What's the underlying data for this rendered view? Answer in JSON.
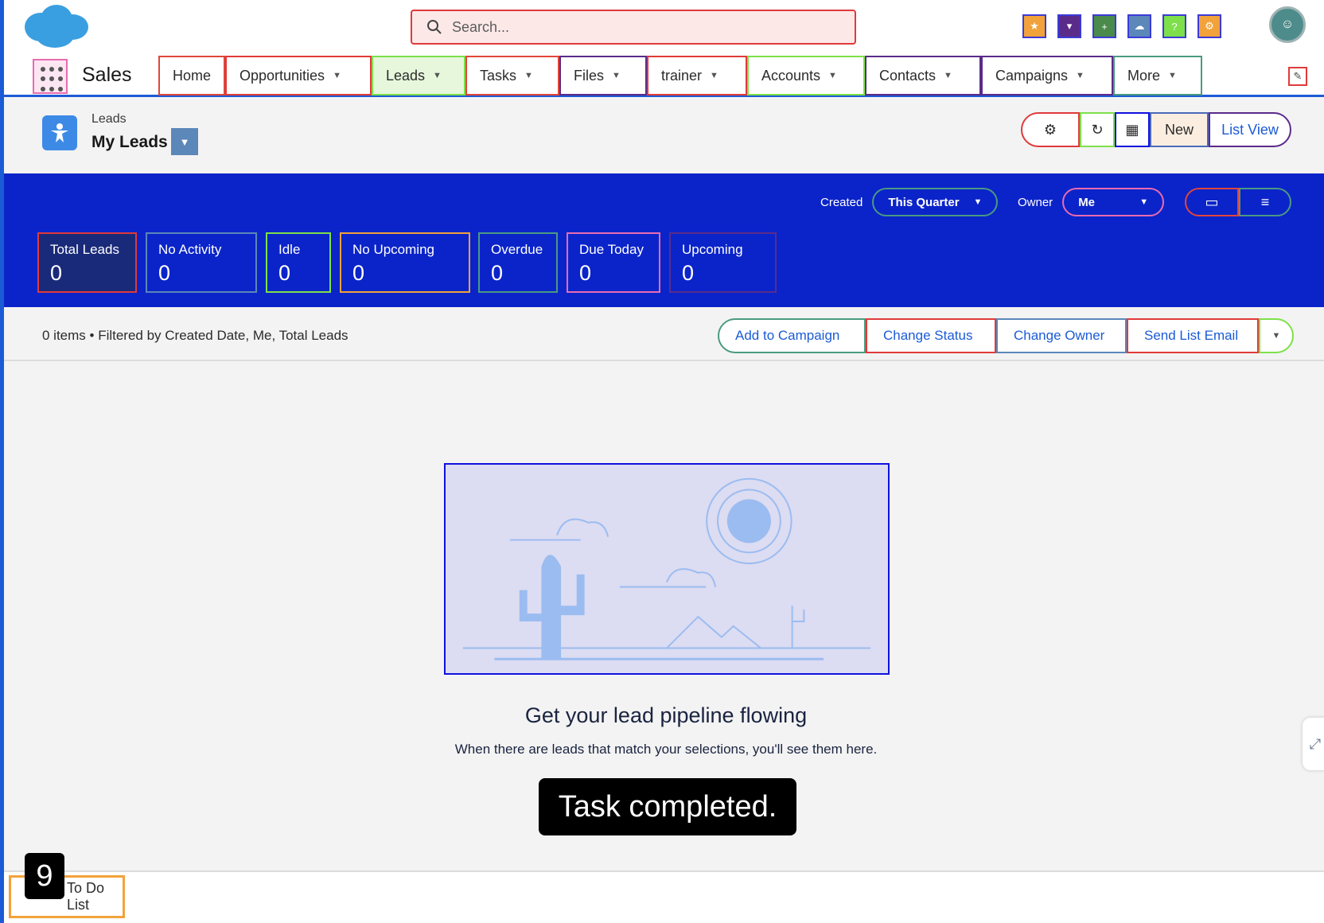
{
  "header": {
    "search_placeholder": "Search...",
    "avatar_initial": ""
  },
  "nav": {
    "app_name": "Sales",
    "tabs": [
      {
        "label": "Home",
        "has_menu": false
      },
      {
        "label": "Opportunities",
        "has_menu": true
      },
      {
        "label": "Leads",
        "has_menu": true
      },
      {
        "label": "Tasks",
        "has_menu": true
      },
      {
        "label": "Files",
        "has_menu": true
      },
      {
        "label": "trainer",
        "has_menu": true
      },
      {
        "label": "Accounts",
        "has_menu": true
      },
      {
        "label": "Contacts",
        "has_menu": true
      },
      {
        "label": "Campaigns",
        "has_menu": true
      },
      {
        "label": "More",
        "has_menu": true
      }
    ]
  },
  "page": {
    "object_label": "Leads",
    "view_title": "My Leads",
    "actions": {
      "new_label": "New",
      "list_view_label": "List View"
    }
  },
  "filters": {
    "created_label": "Created",
    "created_value": "This Quarter",
    "owner_label": "Owner",
    "owner_value": "Me"
  },
  "metrics": [
    {
      "label": "Total Leads",
      "value": "0"
    },
    {
      "label": "No Activity",
      "value": "0"
    },
    {
      "label": "Idle",
      "value": "0"
    },
    {
      "label": "No Upcoming",
      "value": "0"
    },
    {
      "label": "Overdue",
      "value": "0"
    },
    {
      "label": "Due Today",
      "value": "0"
    },
    {
      "label": "Upcoming",
      "value": "0"
    }
  ],
  "list": {
    "info": "0 items • Filtered by Created Date, Me, Total Leads",
    "actions": [
      "Add to Campaign",
      "Change Status",
      "Change Owner",
      "Send List Email"
    ]
  },
  "empty_state": {
    "title": "Get your lead pipeline flowing",
    "subtitle": "When there are leads that match your selections, you'll see them here."
  },
  "toast": "Task completed.",
  "utility": {
    "todo_label": "To Do List"
  },
  "step_badge": "9",
  "colors": {
    "brand_blue": "#0b24c9",
    "accent": "#1b5bd6",
    "object_icon": "#3d8ae6"
  }
}
